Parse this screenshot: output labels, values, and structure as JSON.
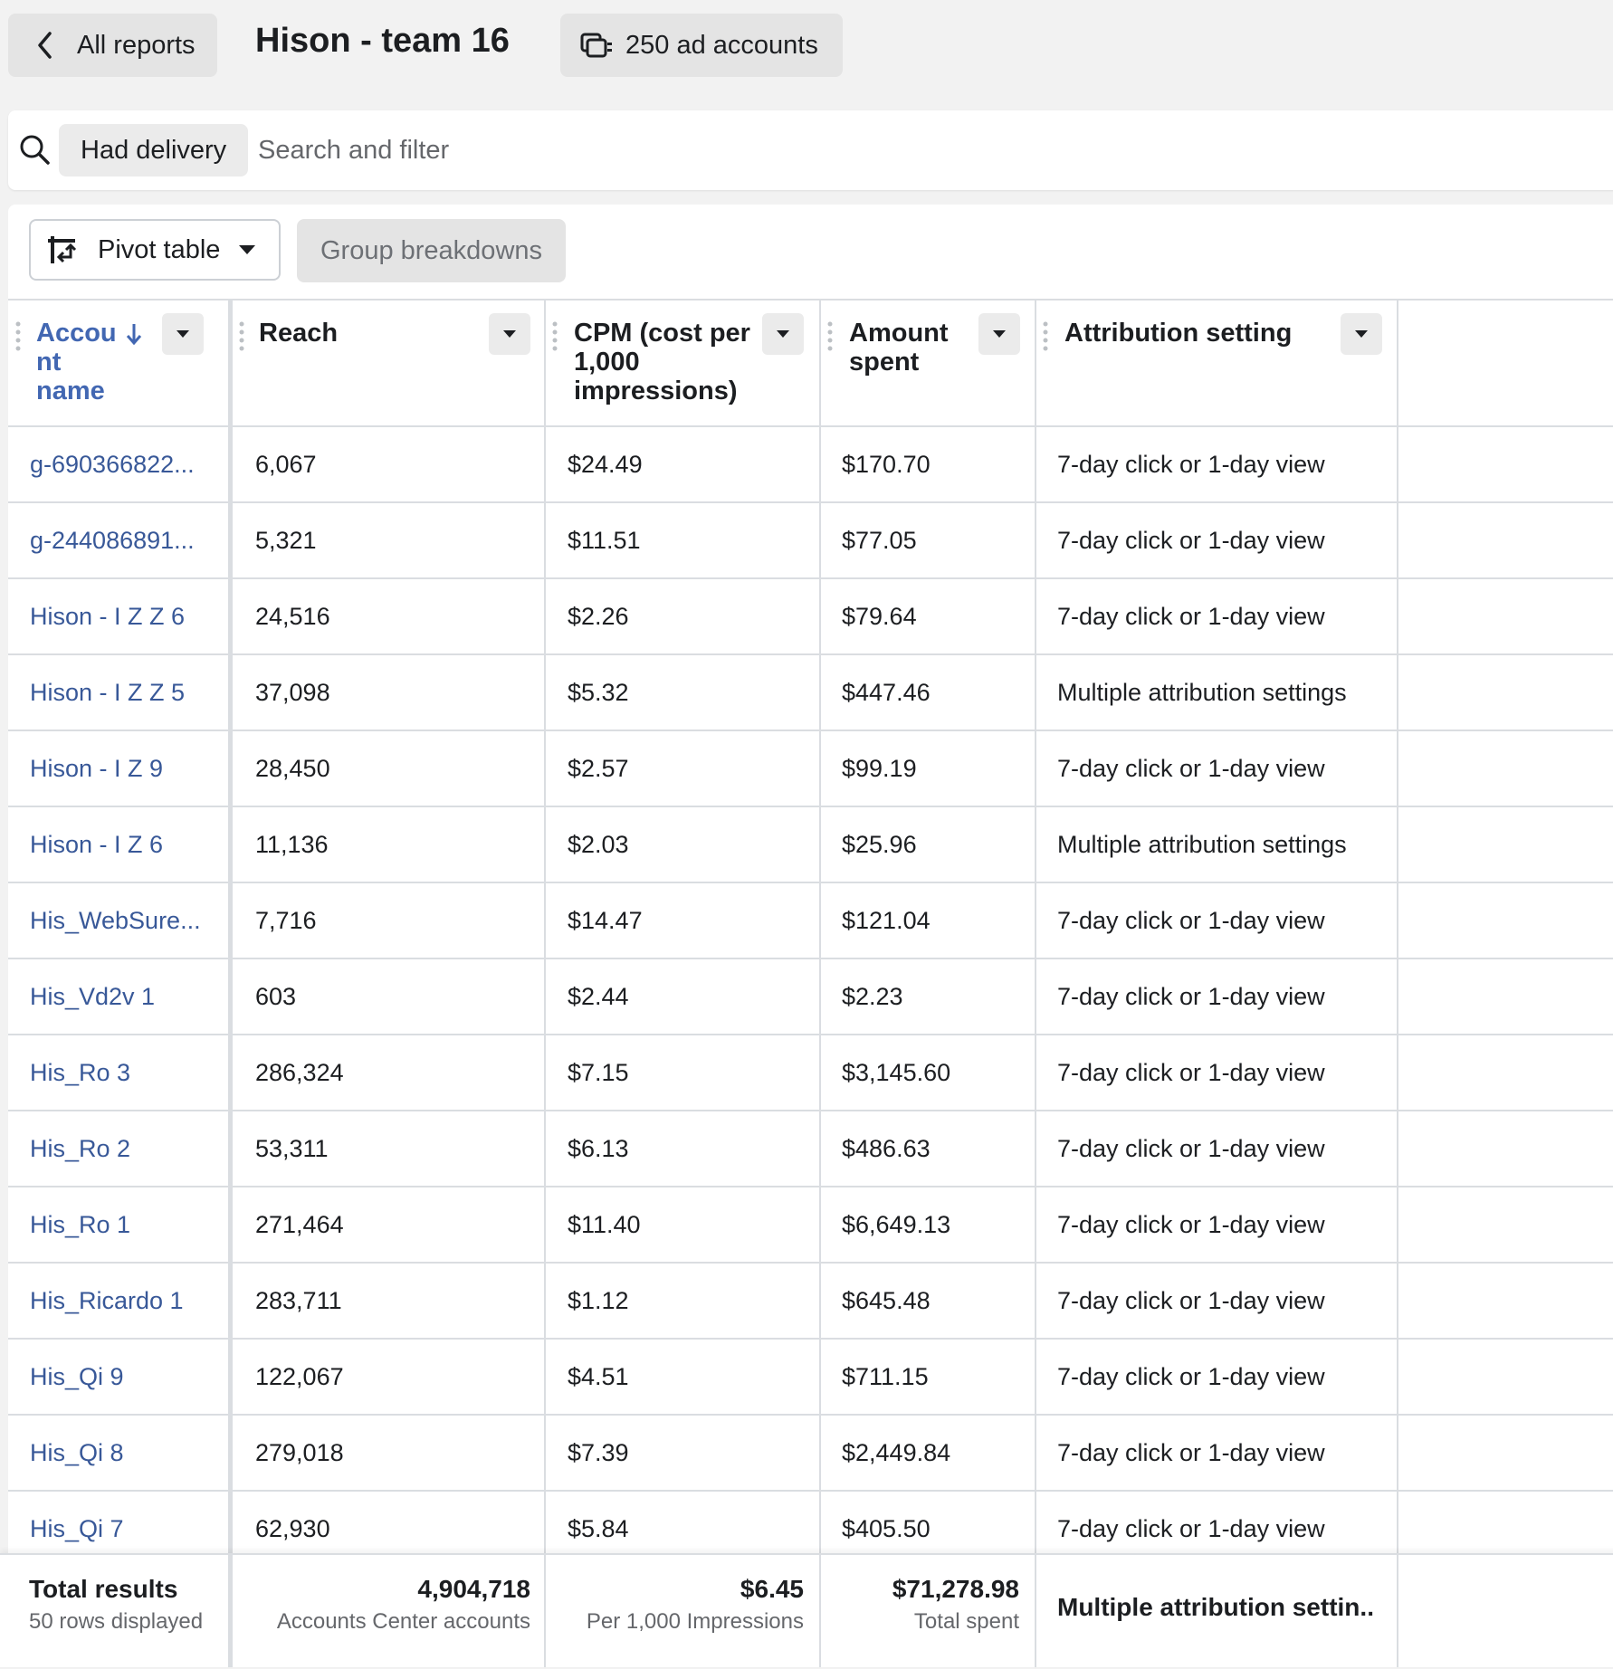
{
  "header": {
    "back_label": "All reports",
    "title": "Hison - team 16",
    "accounts_label": "250 ad accounts"
  },
  "search": {
    "chip": "Had delivery",
    "placeholder": "Search and filter"
  },
  "toolbar": {
    "pivot_label": "Pivot table",
    "group_label": "Group breakdowns"
  },
  "table": {
    "columns": [
      "Accou\nnt\nname",
      "Reach",
      "CPM (cost per\n1,000\nimpressions)",
      "Amount\nspent",
      "Attribution setting"
    ],
    "rows": [
      {
        "name": "g-690366822...",
        "reach": "6,067",
        "cpm": "$24.49",
        "spent": "$170.70",
        "attribution": "7-day click or 1-day view"
      },
      {
        "name": "g-244086891...",
        "reach": "5,321",
        "cpm": "$11.51",
        "spent": "$77.05",
        "attribution": "7-day click or 1-day view"
      },
      {
        "name": "Hison - I Z Z 6",
        "reach": "24,516",
        "cpm": "$2.26",
        "spent": "$79.64",
        "attribution": "7-day click or 1-day view"
      },
      {
        "name": "Hison - I Z Z 5",
        "reach": "37,098",
        "cpm": "$5.32",
        "spent": "$447.46",
        "attribution": "Multiple attribution settings"
      },
      {
        "name": "Hison - I Z 9",
        "reach": "28,450",
        "cpm": "$2.57",
        "spent": "$99.19",
        "attribution": "7-day click or 1-day view"
      },
      {
        "name": "Hison - I Z 6",
        "reach": "11,136",
        "cpm": "$2.03",
        "spent": "$25.96",
        "attribution": "Multiple attribution settings"
      },
      {
        "name": "His_WebSure...",
        "reach": "7,716",
        "cpm": "$14.47",
        "spent": "$121.04",
        "attribution": "7-day click or 1-day view"
      },
      {
        "name": "His_Vd2v 1",
        "reach": "603",
        "cpm": "$2.44",
        "spent": "$2.23",
        "attribution": "7-day click or 1-day view"
      },
      {
        "name": "His_Ro 3",
        "reach": "286,324",
        "cpm": "$7.15",
        "spent": "$3,145.60",
        "attribution": "7-day click or 1-day view"
      },
      {
        "name": "His_Ro 2",
        "reach": "53,311",
        "cpm": "$6.13",
        "spent": "$486.63",
        "attribution": "7-day click or 1-day view"
      },
      {
        "name": "His_Ro 1",
        "reach": "271,464",
        "cpm": "$11.40",
        "spent": "$6,649.13",
        "attribution": "7-day click or 1-day view"
      },
      {
        "name": "His_Ricardo 1",
        "reach": "283,711",
        "cpm": "$1.12",
        "spent": "$645.48",
        "attribution": "7-day click or 1-day view"
      },
      {
        "name": "His_Qi 9",
        "reach": "122,067",
        "cpm": "$4.51",
        "spent": "$711.15",
        "attribution": "7-day click or 1-day view"
      },
      {
        "name": "His_Qi 8",
        "reach": "279,018",
        "cpm": "$7.39",
        "spent": "$2,449.84",
        "attribution": "7-day click or 1-day view"
      },
      {
        "name": "His_Qi 7",
        "reach": "62,930",
        "cpm": "$5.84",
        "spent": "$405.50",
        "attribution": "7-day click or 1-day view"
      }
    ]
  },
  "totals": {
    "label": "Total results",
    "rows_displayed": "50 rows displayed",
    "reach": "4,904,718",
    "reach_sub": "Accounts Center accounts",
    "cpm": "$6.45",
    "cpm_sub": "Per 1,000 Impressions",
    "spent": "$71,278.98",
    "spent_sub": "Total spent",
    "attribution": "Multiple attribution settin..."
  },
  "colors": {
    "link": "#385898",
    "header_sort": "#4267b2",
    "page_bg": "#f2f2f2"
  }
}
